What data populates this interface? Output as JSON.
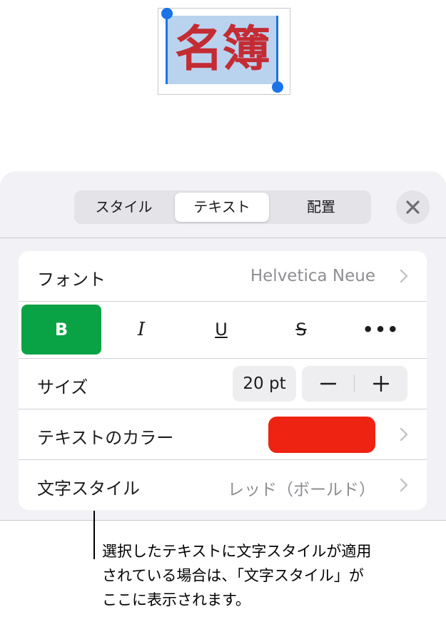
{
  "canvas": {
    "selected_text": "名簿",
    "text_color": "#c42c34",
    "selection_color": "#b9d3ef"
  },
  "panel": {
    "tabs": [
      {
        "label": "スタイル",
        "active": false
      },
      {
        "label": "テキスト",
        "active": true
      },
      {
        "label": "配置",
        "active": false
      }
    ],
    "close_icon": "close-icon"
  },
  "font_row": {
    "label": "フォント",
    "value": "Helvetica Neue"
  },
  "style_buttons": {
    "bold": "B",
    "italic": "I",
    "underline": "U",
    "strikethrough": "S",
    "more": "•••",
    "bold_active": true,
    "active_color": "#09a345"
  },
  "size_row": {
    "label": "サイズ",
    "value": "20 pt"
  },
  "color_row": {
    "label": "テキストのカラー",
    "swatch_color": "#ee2312"
  },
  "char_style_row": {
    "label": "文字スタイル",
    "value": "レッド（ボールド）"
  },
  "callout": {
    "lines": [
      "選択したテキストに文字スタイルが適用",
      "されている場合は、「文字スタイル」が",
      "ここに表示されます。"
    ]
  }
}
